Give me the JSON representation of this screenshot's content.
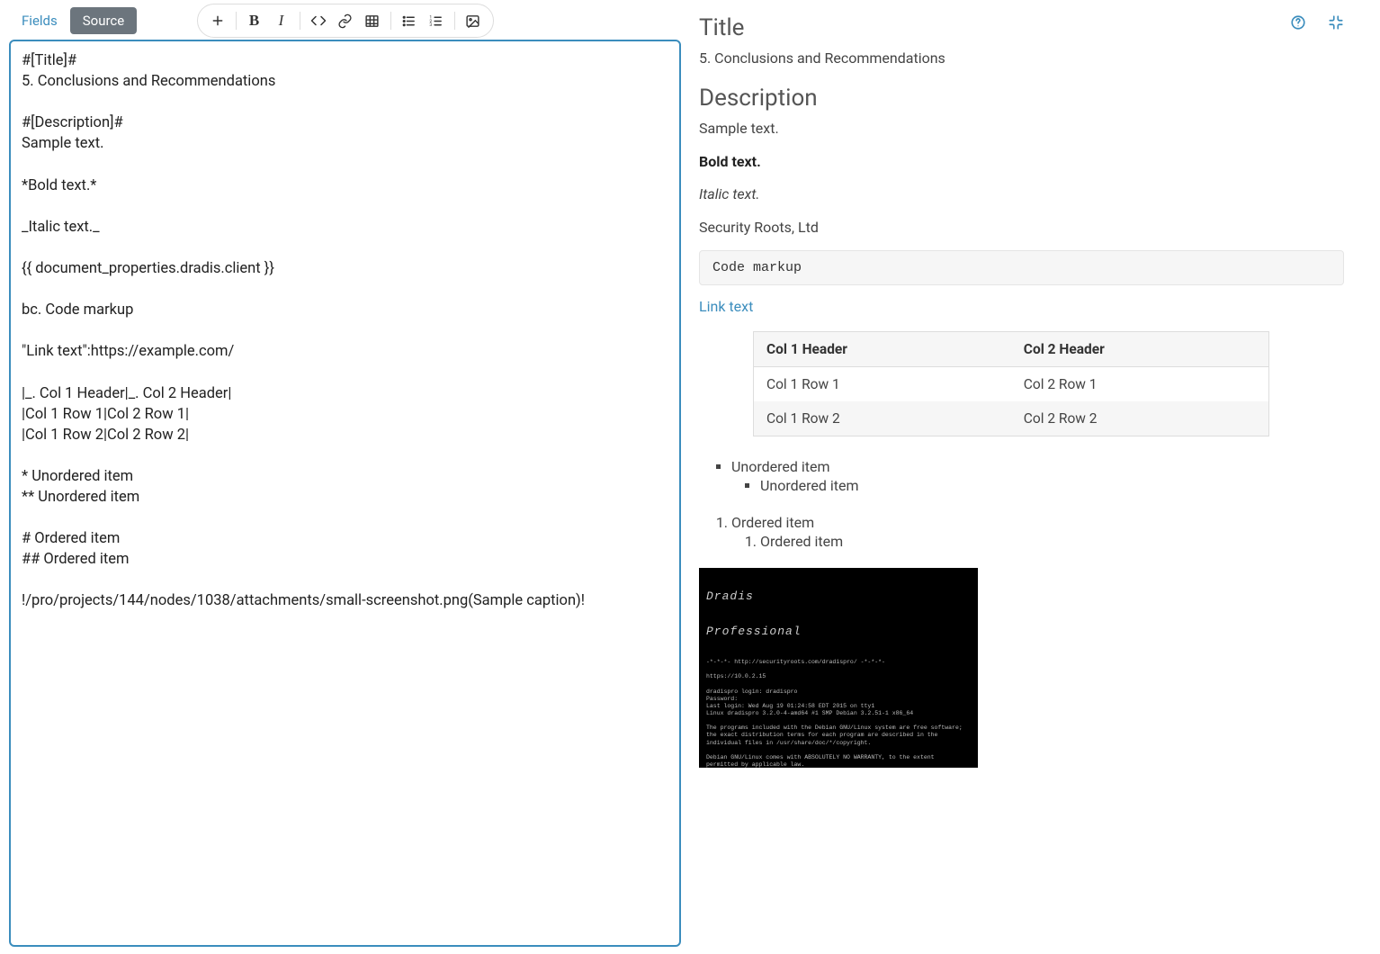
{
  "tabs": {
    "fields": "Fields",
    "source": "Source"
  },
  "editor_content": "#[Title]#\n5. Conclusions and Recommendations\n\n#[Description]#\nSample text.\n\n*Bold text.*\n\n_Italic text._\n\n{{ document_properties.dradis.client }}\n\nbc. Code markup\n\n\"Link text\":https://example.com/\n\n|_. Col 1 Header|_. Col 2 Header|\n|Col 1 Row 1|Col 2 Row 1|\n|Col 1 Row 2|Col 2 Row 2|\n\n* Unordered item\n** Unordered item\n\n# Ordered item\n## Ordered item\n\n!/pro/projects/144/nodes/1038/attachments/small-screenshot.png(Sample caption)!",
  "preview": {
    "title_heading": "Title",
    "title_text": "5. Conclusions and Recommendations",
    "desc_heading": "Description",
    "desc_text": "Sample text.",
    "bold_text": "Bold text.",
    "italic_text": "Italic text.",
    "client": "Security Roots, Ltd",
    "code": "Code markup",
    "link": "Link text",
    "table": {
      "headers": [
        "Col 1 Header",
        "Col 2 Header"
      ],
      "rows": [
        [
          "Col 1 Row 1",
          "Col 2 Row 1"
        ],
        [
          "Col 1 Row 2",
          "Col 2 Row 2"
        ]
      ]
    },
    "ul_item_1": "Unordered item",
    "ul_item_2": "Unordered item",
    "ol_item_1": "Ordered item",
    "ol_item_2": "Ordered item",
    "terminal_ascii_1": "Dradis",
    "terminal_ascii_2": "Professional",
    "terminal_body": "-*-*-*- http://securityroots.com/dradispro/ -*-*-*-\n\nhttps://10.0.2.15\n\ndradispro login: dradispro\nPassword:\nLast login: Wed Aug 19 01:24:58 EDT 2015 on tty1\nLinux dradispro 3.2.0-4-amd64 #1 SMP Debian 3.2.51-1 x86_64\n\nThe programs included with the Debian GNU/Linux system are free software;\nthe exact distribution terms for each program are described in the\nindividual files in /usr/share/doc/*/copyright.\n\nDebian GNU/Linux comes with ABSOLUTELY NO WARRANTY, to the extent\npermitted by applicable law.\ndradispro@dradispro:~$ _"
  }
}
